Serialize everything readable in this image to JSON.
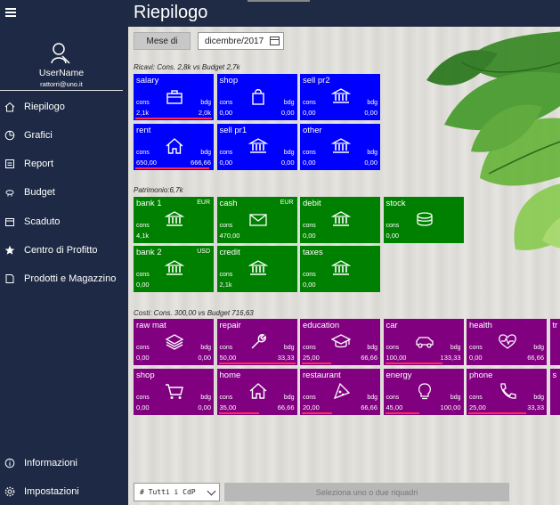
{
  "sidebar": {
    "username": "UserName",
    "email": "rattorri@uno.it",
    "items": [
      {
        "label": "Riepilogo",
        "icon": "home-icon"
      },
      {
        "label": "Grafici",
        "icon": "pie-chart-icon"
      },
      {
        "label": "Report",
        "icon": "report-icon"
      },
      {
        "label": "Budget",
        "icon": "piggy-bank-icon"
      },
      {
        "label": "Scaduto",
        "icon": "calendar-icon"
      },
      {
        "label": "Centro di Profitto",
        "icon": "star-icon"
      },
      {
        "label": "Prodotti e Magazzino",
        "icon": "product-icon"
      }
    ],
    "bottom_items": [
      {
        "label": "Informazioni",
        "icon": "info-icon"
      },
      {
        "label": "Impostazioni",
        "icon": "settings-icon"
      }
    ]
  },
  "header": {
    "title": "Riepilogo"
  },
  "toolbar": {
    "mese_label": "Mese di",
    "month_value": "dicembre/2017"
  },
  "sections": {
    "ricavi": "Ricavi:   Cons.  2,8k   vs Budget  2,7k",
    "patrimonio": "Patrimonio:6,7k",
    "costi": "Costi:   Cons.  300,00  vs Budget  716,63"
  },
  "tiles": {
    "ricavi": [
      {
        "name": "salary",
        "icon": "briefcase-icon",
        "cons_label": "cons",
        "bdg_label": "bdg",
        "cons": "2,1k",
        "bdg": "2,0k",
        "bar": 1.0
      },
      {
        "name": "shop",
        "icon": "shopping-bag-icon",
        "cons_label": "cons",
        "bdg_label": "bdg",
        "cons": "0,00",
        "bdg": "0,00",
        "bar": 0
      },
      {
        "name": "sell pr2",
        "icon": "bank-icon",
        "cons_label": "cons",
        "bdg_label": "bdg",
        "cons": "0,00",
        "bdg": "0,00",
        "bar": 0
      },
      {
        "name": "rent",
        "icon": "home-icon",
        "cons_label": "cons",
        "bdg_label": "bdg",
        "cons": "650,00",
        "bdg": "666,66",
        "bar": 0.97
      },
      {
        "name": "sell pr1",
        "icon": "bank-icon",
        "cons_label": "cons",
        "bdg_label": "bdg",
        "cons": "0,00",
        "bdg": "0,00",
        "bar": 0
      },
      {
        "name": "other",
        "icon": "bank-icon",
        "cons_label": "cons",
        "bdg_label": "bdg",
        "cons": "0,00",
        "bdg": "0,00",
        "bar": 0
      }
    ],
    "patrimonio": [
      {
        "name": "bank 1",
        "currency": "EUR",
        "icon": "bank-icon",
        "cons_label": "cons",
        "cons": "4,1k"
      },
      {
        "name": "cash",
        "currency": "EUR",
        "icon": "envelope-icon",
        "cons_label": "cons",
        "cons": "470,00"
      },
      {
        "name": "debit",
        "icon": "bank-icon",
        "cons_label": "cons",
        "cons": "0,00"
      },
      {
        "name": "stock",
        "icon": "database-icon",
        "cons_label": "cons",
        "cons": "0,00"
      },
      {
        "name": "bank 2",
        "currency": "USD",
        "icon": "bank-icon",
        "cons_label": "cons",
        "cons": "0,00"
      },
      {
        "name": "credit",
        "icon": "bank-icon",
        "cons_label": "cons",
        "cons": "2,1k"
      },
      {
        "name": "taxes",
        "icon": "bank-icon",
        "cons_label": "cons",
        "cons": "0,00"
      }
    ],
    "costi": [
      {
        "name": "raw mat",
        "icon": "layers-icon",
        "cons_label": "cons",
        "bdg_label": "bdg",
        "cons": "0,00",
        "bdg": "0,00",
        "bar": 0
      },
      {
        "name": "repair",
        "icon": "wrench-icon",
        "cons_label": "cons",
        "bdg_label": "bdg",
        "cons": "50,00",
        "bdg": "33,33",
        "bar": 1.0
      },
      {
        "name": "education",
        "icon": "graduation-cap-icon",
        "cons_label": "cons",
        "bdg_label": "bdg",
        "cons": "25,00",
        "bdg": "66,66",
        "bar": 0.38
      },
      {
        "name": "car",
        "icon": "car-icon",
        "cons_label": "cons",
        "bdg_label": "bdg",
        "cons": "100,00",
        "bdg": "133,33",
        "bar": 0.75
      },
      {
        "name": "health",
        "icon": "heart-pulse-icon",
        "cons_label": "cons",
        "bdg_label": "bdg",
        "cons": "0,00",
        "bdg": "66,66",
        "bar": 0
      },
      {
        "name": "tr",
        "icon": "",
        "cons_label": "",
        "bdg_label": "",
        "cons": "",
        "bdg": "",
        "bar": 0
      },
      {
        "name": "shop",
        "icon": "cart-icon",
        "cons_label": "cons",
        "bdg_label": "bdg",
        "cons": "0,00",
        "bdg": "0,00",
        "bar": 0
      },
      {
        "name": "home",
        "icon": "home-icon",
        "cons_label": "cons",
        "bdg_label": "bdg",
        "cons": "35,00",
        "bdg": "66,66",
        "bar": 0.53
      },
      {
        "name": "restaurant",
        "icon": "pizza-icon",
        "cons_label": "cons",
        "bdg_label": "bdg",
        "cons": "20,00",
        "bdg": "66,66",
        "bar": 0.4
      },
      {
        "name": "energy",
        "icon": "lightbulb-icon",
        "cons_label": "cons",
        "bdg_label": "bdg",
        "cons": "45,00",
        "bdg": "100,00",
        "bar": 0.45
      },
      {
        "name": "phone",
        "icon": "phone-icon",
        "cons_label": "cons",
        "bdg_label": "bdg",
        "cons": "25,00",
        "bdg": "33,33",
        "bar": 0.75
      },
      {
        "name": "s",
        "icon": "",
        "cons_label": "",
        "bdg_label": "",
        "cons": "",
        "bdg": "",
        "bar": 0
      }
    ]
  },
  "footer": {
    "cdp_value": "# Tutti i CdP",
    "hint": "Seleziona uno o due riquadri"
  }
}
